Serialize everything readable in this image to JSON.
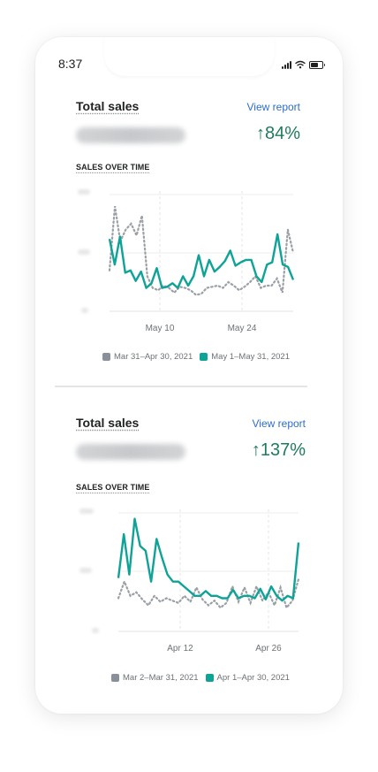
{
  "status_bar": {
    "time": "8:37"
  },
  "colors": {
    "current": "#0fa397",
    "previous": "#9aa0a6",
    "positive": "#1d7c59",
    "link": "#2c6ecb"
  },
  "cards": [
    {
      "title": "Total sales",
      "view_report": "View report",
      "change": "84%",
      "section_title": "SALES OVER TIME",
      "x_ticks": [
        "May 10",
        "May 24"
      ],
      "legend": {
        "previous": "Mar 31–Apr 30, 2021",
        "current": "May 1–May 31, 2021"
      }
    },
    {
      "title": "Total sales",
      "view_report": "View report",
      "change": "137%",
      "section_title": "SALES OVER TIME",
      "x_ticks": [
        "Apr 12",
        "Apr 26"
      ],
      "legend": {
        "previous": "Mar 2–Mar 31, 2021",
        "current": "Apr 1–Apr 30, 2021"
      }
    }
  ],
  "chart_data": [
    {
      "type": "line",
      "x_ticks": [
        "May 10",
        "May 24"
      ],
      "series": [
        {
          "name": "May 1–May 31, 2021",
          "style": "solid",
          "color": "#0fa397",
          "values": [
            62,
            40,
            64,
            33,
            35,
            26,
            34,
            20,
            24,
            37,
            20,
            21,
            24,
            20,
            30,
            22,
            30,
            48,
            30,
            44,
            34,
            38,
            43,
            52,
            39,
            42,
            44,
            44,
            30,
            25,
            40,
            42,
            66,
            40,
            38,
            27
          ]
        },
        {
          "name": "Mar 31–Apr 30, 2021",
          "style": "dotted",
          "color": "#9aa0a6",
          "values": [
            35,
            90,
            60,
            70,
            75,
            65,
            82,
            30,
            20,
            18,
            22,
            20,
            16,
            21,
            20,
            18,
            14,
            15,
            20,
            21,
            22,
            20,
            25,
            22,
            18,
            21,
            25,
            30,
            20,
            22,
            22,
            28,
            16,
            70,
            50
          ]
        }
      ]
    },
    {
      "type": "line",
      "x_ticks": [
        "Apr 12",
        "Apr 26"
      ],
      "series": [
        {
          "name": "Apr 1–Apr 30, 2021",
          "style": "solid",
          "color": "#0fa397",
          "values": [
            45,
            82,
            48,
            95,
            72,
            68,
            42,
            78,
            62,
            48,
            42,
            42,
            38,
            34,
            30,
            30,
            34,
            30,
            30,
            28,
            28,
            35,
            28,
            30,
            30,
            28,
            36,
            27,
            38,
            30,
            26,
            30,
            28,
            75
          ]
        },
        {
          "name": "Mar 2–Mar 31, 2021",
          "style": "dotted",
          "color": "#9aa0a6",
          "values": [
            28,
            42,
            30,
            33,
            27,
            22,
            30,
            25,
            28,
            26,
            24,
            30,
            25,
            37,
            27,
            22,
            26,
            20,
            24,
            38,
            25,
            37,
            24,
            38,
            26,
            33,
            22,
            37,
            20,
            26,
            44
          ]
        }
      ]
    }
  ]
}
